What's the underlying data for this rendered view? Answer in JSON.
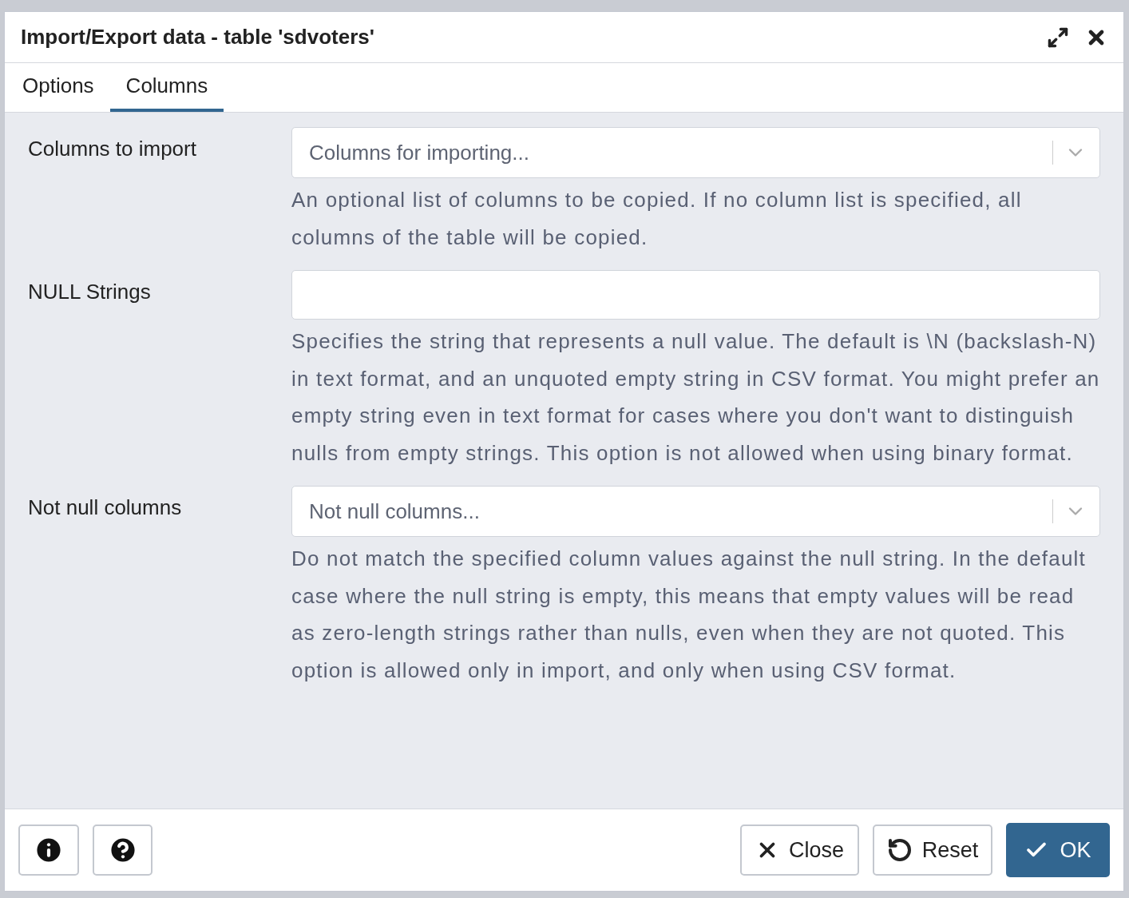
{
  "dialog": {
    "title": "Import/Export data - table 'sdvoters'"
  },
  "tabs": [
    {
      "label": "Options",
      "selected": false
    },
    {
      "label": "Columns",
      "selected": true
    }
  ],
  "fields": [
    {
      "kind": "select",
      "label": "Columns to import",
      "placeholder": "Columns for importing...",
      "help": "An optional list of columns to be copied. If no column list is specified, all columns of the table will be copied."
    },
    {
      "kind": "input",
      "label": "NULL Strings",
      "help": "Specifies the string that represents a null value. The default is \\N (backslash-N) in text format, and an unquoted empty string in CSV format. You might prefer an empty string even in text format for cases where you don't want to distinguish nulls from empty strings. This option is not allowed when using binary format."
    },
    {
      "kind": "select",
      "label": "Not null columns",
      "placeholder": "Not null columns...",
      "help": "Do not match the specified column values against the null string. In the default case where the null string is empty, this means that empty values will be read as zero-length strings rather than nulls, even when they are not quoted. This option is allowed only in import, and only when using CSV format."
    }
  ],
  "footer": {
    "close": "Close",
    "reset": "Reset",
    "ok": "OK"
  }
}
